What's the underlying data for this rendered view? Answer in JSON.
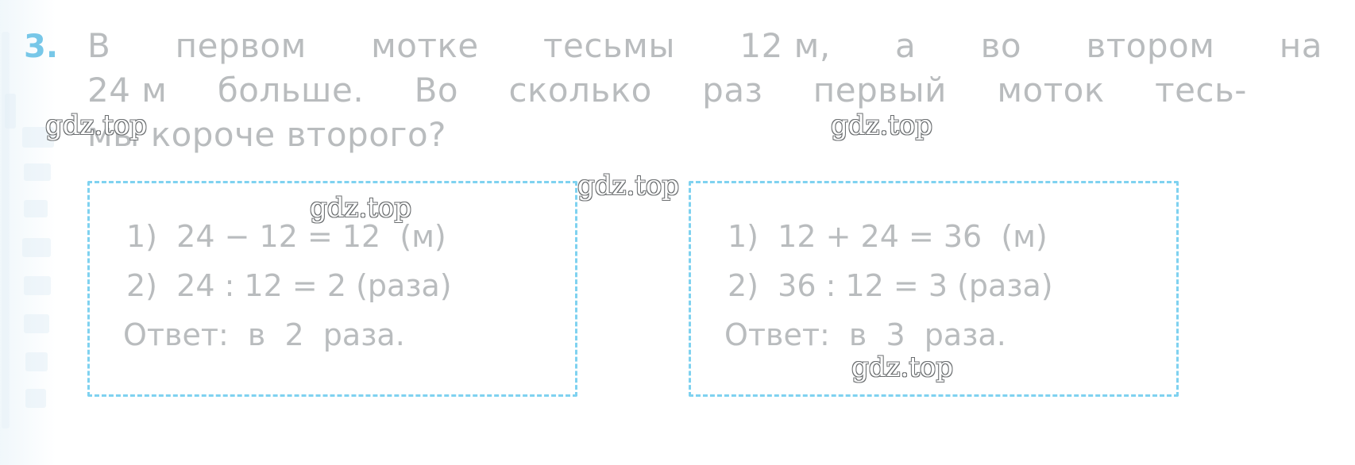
{
  "task": {
    "number": "3.",
    "statement_lines": [
      "В  первом  мотке  тесьмы  12 м,  а  во  втором  на",
      "24 м  больше.  Во  сколько  раз  первый  моток  тесь-",
      "мы  короче  второго?"
    ],
    "statement_line1_words": [
      "В",
      "первом",
      "мотке",
      "тесьмы",
      "12 м,",
      "а",
      "во",
      "втором",
      "на"
    ],
    "statement_line2_words": [
      "24 м",
      "больше.",
      "Во",
      "сколько",
      "раз",
      "первый",
      "моток",
      "тесь-"
    ],
    "statement_line3": "мы  короче  второго?"
  },
  "boxes": [
    {
      "name": "left-answer-box",
      "lines": [
        "1)  24 − 12 = 12  (м)",
        "2)  24 : 12 = 2 (раза)",
        "Ответ:  в  2  раза."
      ]
    },
    {
      "name": "right-answer-box",
      "lines": [
        "1)  12 + 24 = 36  (м)",
        "2)  36 : 12 = 3 (раза)",
        "Ответ:  в  3  раза."
      ]
    }
  ],
  "watermarks": [
    "gdz.top",
    "gdz.top",
    "gdz.top",
    "gdz.top",
    "gdz.top"
  ],
  "colors": {
    "task_number": "#77c7e8",
    "text": "#b9bcbe",
    "box_border": "#7fd2f0",
    "background": "#ffffff"
  }
}
